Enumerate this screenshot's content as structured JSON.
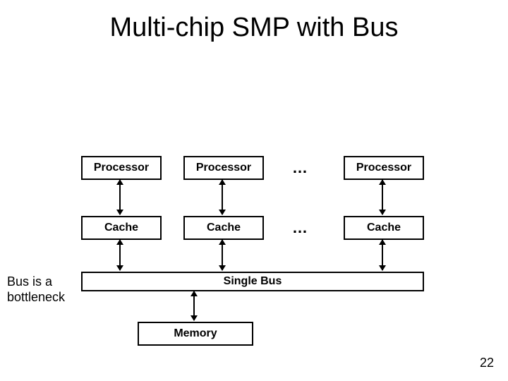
{
  "title": "Multi-chip SMP with Bus",
  "row1": {
    "b1": "Processor",
    "b2": "Processor",
    "ell": "…",
    "b4": "Processor"
  },
  "row2": {
    "b1": "Cache",
    "b2": "Cache",
    "ell": "…",
    "b4": "Cache"
  },
  "bus": "Single Bus",
  "memory": "Memory",
  "note": "Bus is a\nbottleneck",
  "pagenum": "22"
}
